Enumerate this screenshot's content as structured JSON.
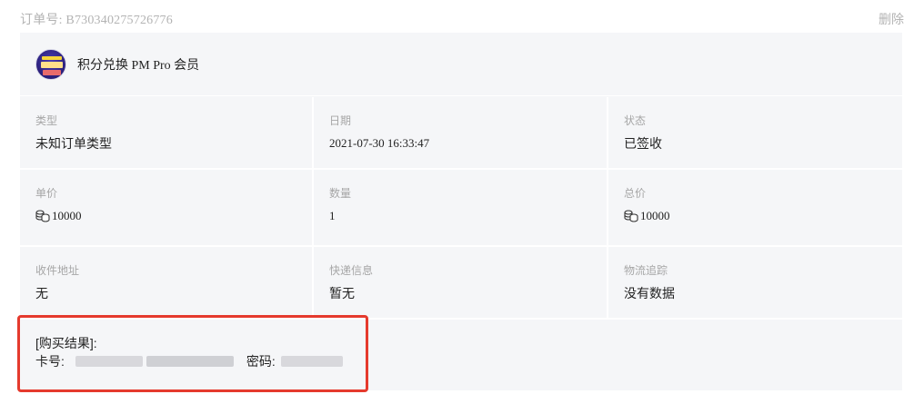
{
  "order": {
    "number_label": "订单号:",
    "number": "B730340275726776",
    "delete_label": "删除"
  },
  "product": {
    "title": "积分兑换 PM Pro 会员",
    "icon": "pm-pro-avatar-icon"
  },
  "details": {
    "type_label": "类型",
    "type_value": "未知订单类型",
    "date_label": "日期",
    "date_value": "2021-07-30 16:33:47",
    "status_label": "状态",
    "status_value": "已签收",
    "unit_price_label": "单价",
    "unit_price_value": "10000",
    "quantity_label": "数量",
    "quantity_value": "1",
    "total_label": "总价",
    "total_value": "10000",
    "address_label": "收件地址",
    "address_value": "无",
    "express_label": "快递信息",
    "express_value": "暂无",
    "tracking_label": "物流追踪",
    "tracking_value": "没有数据"
  },
  "result": {
    "title": "[购买结果]:",
    "card_label": "卡号:",
    "password_label": "密码:"
  },
  "colors": {
    "highlight": "#e53a2d",
    "card_bg": "#f5f6f8",
    "muted_text": "#b3b3b3"
  }
}
